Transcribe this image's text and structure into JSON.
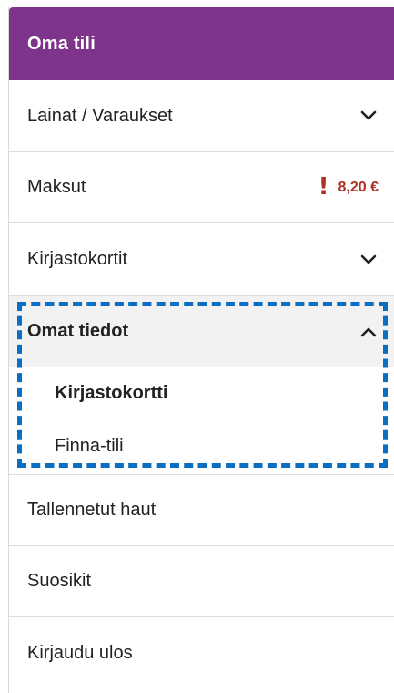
{
  "menu": {
    "title": "Oma tili",
    "items": [
      {
        "label": "Lainat / Varaukset",
        "icon": "chevron-down-icon"
      },
      {
        "label": "Maksut",
        "fee": "8,20 €",
        "fee_icon": "exclamation-icon",
        "fee_color": "#b03024"
      },
      {
        "label": "Kirjastokortit",
        "icon": "chevron-down-icon"
      },
      {
        "label": "Omat tiedot",
        "icon": "chevron-up-icon",
        "expanded": true,
        "subitems": [
          {
            "label": "Kirjastokortti",
            "active": true
          },
          {
            "label": "Finna-tili"
          }
        ]
      },
      {
        "label": "Tallennetut haut"
      },
      {
        "label": "Suosikit"
      },
      {
        "label": "Kirjaudu ulos"
      }
    ]
  },
  "colors": {
    "header_bg": "#7f348b",
    "highlight_border": "#0a6fc2",
    "expanded_bg": "#f2f2f2"
  }
}
